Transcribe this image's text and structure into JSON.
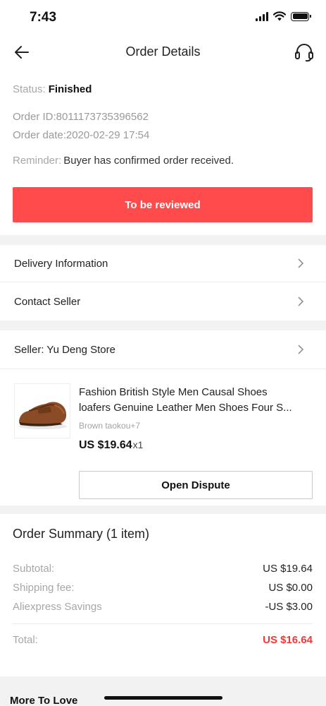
{
  "status_bar": {
    "time": "7:43"
  },
  "header": {
    "title": "Order Details"
  },
  "order": {
    "status_label": "Status:",
    "status_value": "Finished",
    "order_id": "Order ID:8011173735396562",
    "order_date": "Order date:2020-02-29 17:54",
    "reminder_label": "Reminder:",
    "reminder_value": "Buyer has confirmed order received.",
    "review_button": "To be reviewed"
  },
  "links": {
    "delivery": "Delivery Information",
    "contact": "Contact Seller"
  },
  "seller": {
    "label": "Seller: Yu Deng Store"
  },
  "product": {
    "title_line1": "Fashion British Style Men Causal Shoes",
    "title_line2": "loafers Genuine Leather Men Shoes Four S...",
    "variant": "Brown taokou+7",
    "price": "US $19.64",
    "quantity": "x1",
    "dispute_button": "Open Dispute"
  },
  "summary": {
    "title": "Order Summary (1 item)",
    "rows": [
      {
        "label": "Subtotal:",
        "value": "US $19.64"
      },
      {
        "label": "Shipping fee:",
        "value": "US $0.00"
      },
      {
        "label": "Aliexpress Savings",
        "value": "-US $3.00"
      }
    ],
    "total_label": "Total:",
    "total_value": "US $16.64"
  },
  "more": {
    "label": "More To Love"
  },
  "colors": {
    "accent": "#ff4b4b",
    "total": "#ff3333"
  },
  "icons": [
    "back-arrow-icon",
    "headset-icon",
    "chevron-right-icon",
    "signal-icon",
    "wifi-icon",
    "battery-icon"
  ]
}
